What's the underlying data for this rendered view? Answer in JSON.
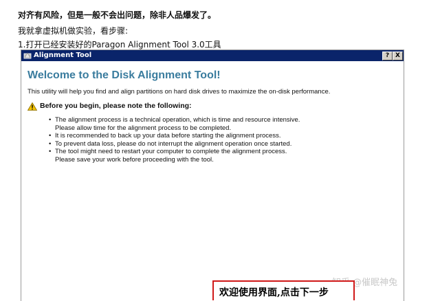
{
  "article": {
    "line1": "对齐有风险，但是一般不会出问题，除非人品爆发了。",
    "line2": "我就拿虚拟机做实验，看步骤:",
    "line3": "1.打开已经安装好的Paragon Alignment Tool 3.0工具"
  },
  "dialog": {
    "title": "Alignment Tool",
    "help_label": "?",
    "close_label": "X",
    "heading": "Welcome to the Disk Alignment Tool!",
    "intro": "This utility will help you find and align partitions on hard disk drives to maximize the on-disk performance.",
    "warning_heading": "Before you begin, please note the following:",
    "bullets": [
      {
        "line1": "The alignment process is a technical operation, which is time and resource intensive.",
        "line2": "Please allow time for the alignment process to be completed."
      },
      {
        "line1": "It is recommended to back up your data before starting the alignment process.",
        "line2": ""
      },
      {
        "line1": "To prevent data loss, please do not interrupt the alignment operation once started.",
        "line2": ""
      },
      {
        "line1": "The tool might need to restart your computer to complete the alignment process.",
        "line2": "Please save your work before proceeding with the tool."
      }
    ]
  },
  "annotation": {
    "caption": "欢迎使用界面,点击下一步"
  },
  "watermark": "知乎 @催眠神兔",
  "icons": {
    "app_icon": "alignment-tool-app-icon",
    "warning_icon": "warning-triangle-icon"
  },
  "colors": {
    "titlebar": "#0a246a",
    "heading": "#3a7c9e",
    "caption_border": "#d01818",
    "warning_icon": "#f2c200"
  }
}
